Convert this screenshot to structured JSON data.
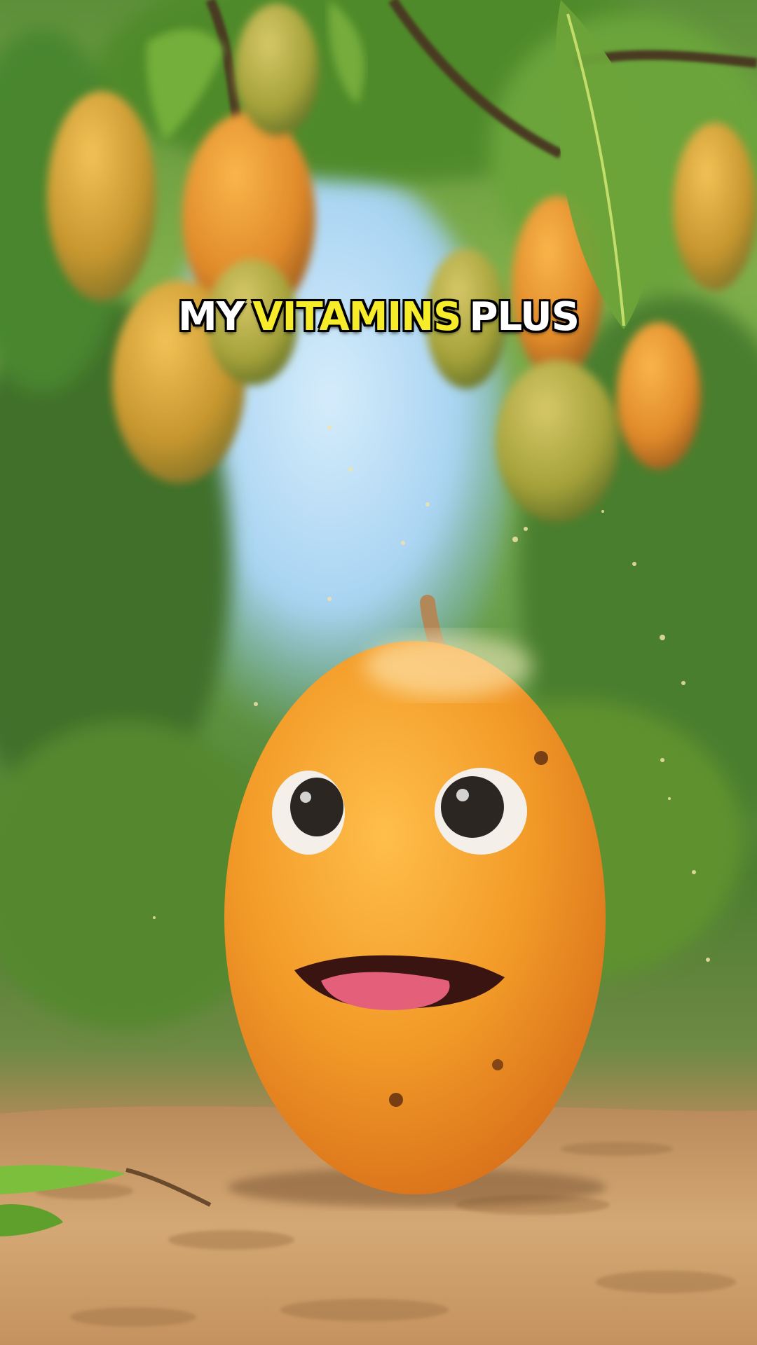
{
  "caption": {
    "word1": "MY",
    "word2": "VITAMINS",
    "word3": "PLUS"
  },
  "colors": {
    "caption_text": "#ffffff",
    "caption_highlight": "#f7ec29",
    "mango_body": "#f29a28",
    "sky": "#a8d4f2",
    "soil": "#c89a68"
  }
}
